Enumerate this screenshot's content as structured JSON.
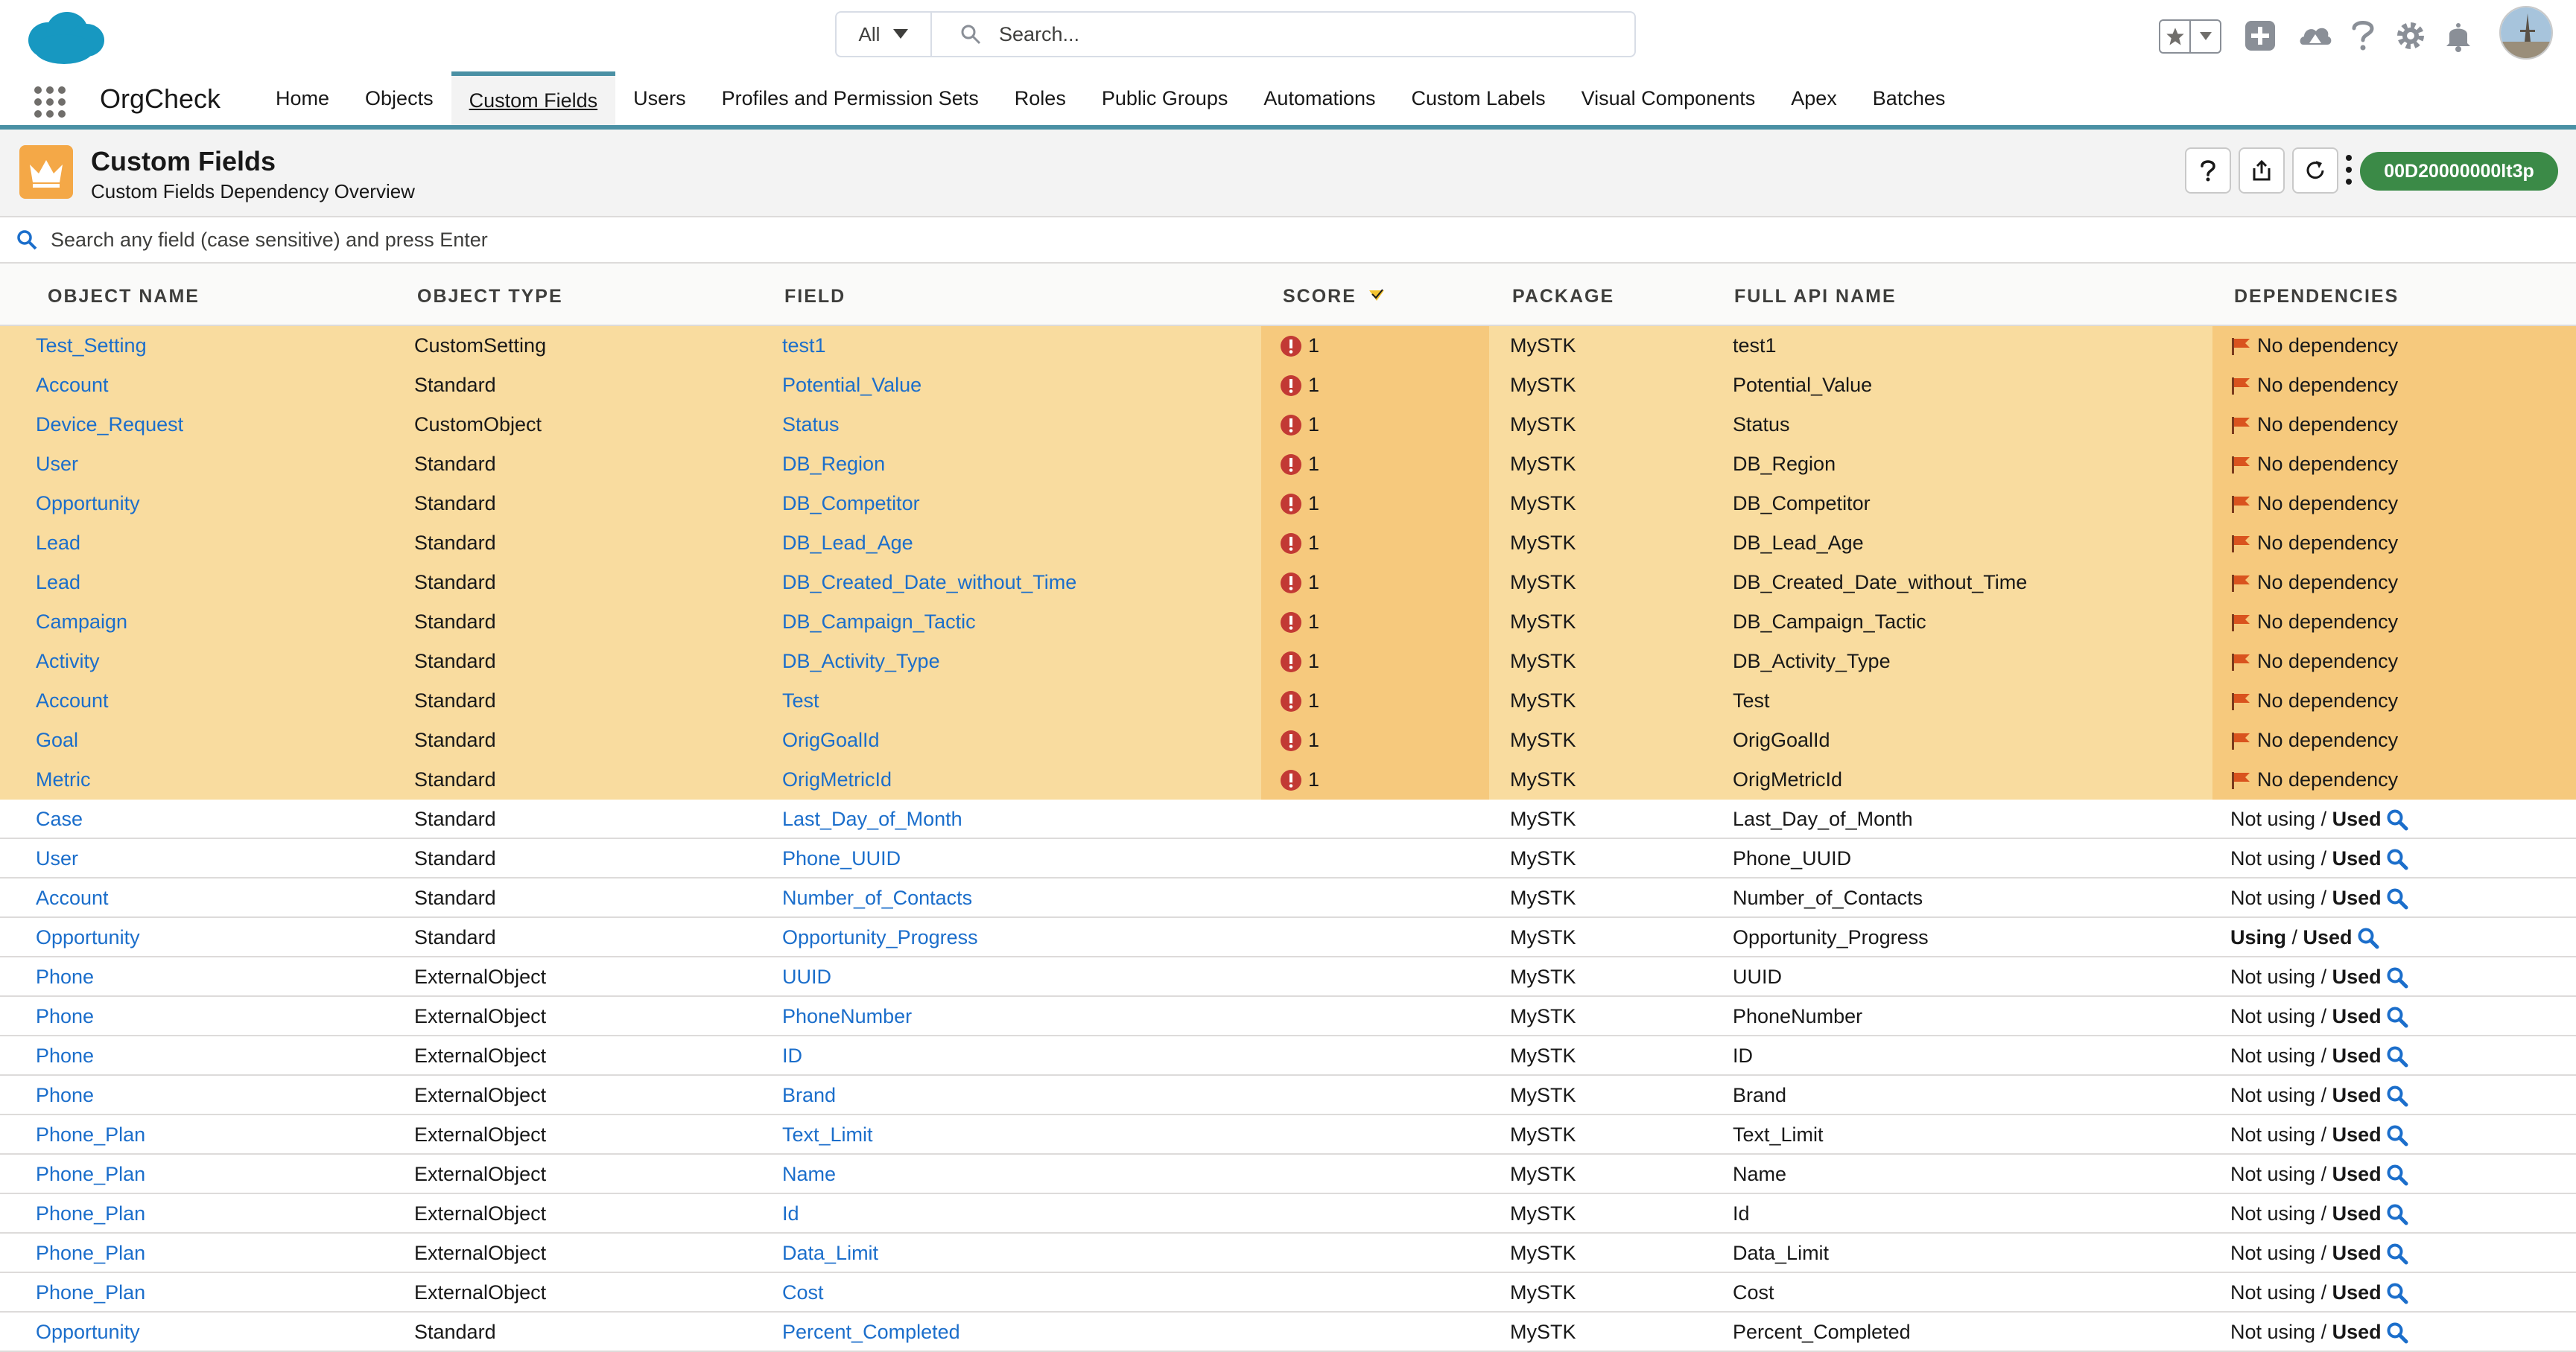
{
  "global": {
    "search_scope": "All",
    "search_placeholder": "Search..."
  },
  "nav": {
    "app_name": "OrgCheck",
    "items": [
      "Home",
      "Objects",
      "Custom Fields",
      "Users",
      "Profiles and Permission Sets",
      "Roles",
      "Public Groups",
      "Automations",
      "Custom Labels",
      "Visual Components",
      "Apex",
      "Batches"
    ],
    "active_index": 2
  },
  "page_header": {
    "title": "Custom Fields",
    "subtitle": "Custom Fields Dependency Overview",
    "org_id": "00D20000000lt3p"
  },
  "filter": {
    "placeholder": "Search any field (case sensitive) and press Enter"
  },
  "table": {
    "columns": [
      "OBJECT NAME",
      "OBJECT TYPE",
      "FIELD",
      "SCORE",
      "PACKAGE",
      "FULL API NAME",
      "DEPENDENCIES"
    ],
    "rows": [
      {
        "object": "Test_Setting",
        "type": "CustomSetting",
        "field": "test1",
        "score": "1",
        "package": "MySTK",
        "api": "test1",
        "dep": "No dependency"
      },
      {
        "object": "Account",
        "type": "Standard",
        "field": "Potential_Value",
        "score": "1",
        "package": "MySTK",
        "api": "Potential_Value",
        "dep": "No dependency"
      },
      {
        "object": "Device_Request",
        "type": "CustomObject",
        "field": "Status",
        "score": "1",
        "package": "MySTK",
        "api": "Status",
        "dep": "No dependency"
      },
      {
        "object": "User",
        "type": "Standard",
        "field": "DB_Region",
        "score": "1",
        "package": "MySTK",
        "api": "DB_Region",
        "dep": "No dependency"
      },
      {
        "object": "Opportunity",
        "type": "Standard",
        "field": "DB_Competitor",
        "score": "1",
        "package": "MySTK",
        "api": "DB_Competitor",
        "dep": "No dependency"
      },
      {
        "object": "Lead",
        "type": "Standard",
        "field": "DB_Lead_Age",
        "score": "1",
        "package": "MySTK",
        "api": "DB_Lead_Age",
        "dep": "No dependency"
      },
      {
        "object": "Lead",
        "type": "Standard",
        "field": "DB_Created_Date_without_Time",
        "score": "1",
        "package": "MySTK",
        "api": "DB_Created_Date_without_Time",
        "dep": "No dependency"
      },
      {
        "object": "Campaign",
        "type": "Standard",
        "field": "DB_Campaign_Tactic",
        "score": "1",
        "package": "MySTK",
        "api": "DB_Campaign_Tactic",
        "dep": "No dependency"
      },
      {
        "object": "Activity",
        "type": "Standard",
        "field": "DB_Activity_Type",
        "score": "1",
        "package": "MySTK",
        "api": "DB_Activity_Type",
        "dep": "No dependency"
      },
      {
        "object": "Account",
        "type": "Standard",
        "field": "Test",
        "score": "1",
        "package": "MySTK",
        "api": "Test",
        "dep": "No dependency"
      },
      {
        "object": "Goal",
        "type": "Standard",
        "field": "OrigGoalId",
        "score": "1",
        "package": "MySTK",
        "api": "OrigGoalId",
        "dep": "No dependency"
      },
      {
        "object": "Metric",
        "type": "Standard",
        "field": "OrigMetricId",
        "score": "1",
        "package": "MySTK",
        "api": "OrigMetricId",
        "dep": "No dependency"
      },
      {
        "object": "Case",
        "type": "Standard",
        "field": "Last_Day_of_Month",
        "score": "",
        "package": "MySTK",
        "api": "Last_Day_of_Month",
        "using": "Not using",
        "used": "Used",
        "using_bold": false
      },
      {
        "object": "User",
        "type": "Standard",
        "field": "Phone_UUID",
        "score": "",
        "package": "MySTK",
        "api": "Phone_UUID",
        "using": "Not using",
        "used": "Used",
        "using_bold": false
      },
      {
        "object": "Account",
        "type": "Standard",
        "field": "Number_of_Contacts",
        "score": "",
        "package": "MySTK",
        "api": "Number_of_Contacts",
        "using": "Not using",
        "used": "Used",
        "using_bold": false
      },
      {
        "object": "Opportunity",
        "type": "Standard",
        "field": "Opportunity_Progress",
        "score": "",
        "package": "MySTK",
        "api": "Opportunity_Progress",
        "using": "Using",
        "used": "Used",
        "using_bold": true
      },
      {
        "object": "Phone",
        "type": "ExternalObject",
        "field": "UUID",
        "score": "",
        "package": "MySTK",
        "api": "UUID",
        "using": "Not using",
        "used": "Used",
        "using_bold": false
      },
      {
        "object": "Phone",
        "type": "ExternalObject",
        "field": "PhoneNumber",
        "score": "",
        "package": "MySTK",
        "api": "PhoneNumber",
        "using": "Not using",
        "used": "Used",
        "using_bold": false
      },
      {
        "object": "Phone",
        "type": "ExternalObject",
        "field": "ID",
        "score": "",
        "package": "MySTK",
        "api": "ID",
        "using": "Not using",
        "used": "Used",
        "using_bold": false
      },
      {
        "object": "Phone",
        "type": "ExternalObject",
        "field": "Brand",
        "score": "",
        "package": "MySTK",
        "api": "Brand",
        "using": "Not using",
        "used": "Used",
        "using_bold": false
      },
      {
        "object": "Phone_Plan",
        "type": "ExternalObject",
        "field": "Text_Limit",
        "score": "",
        "package": "MySTK",
        "api": "Text_Limit",
        "using": "Not using",
        "used": "Used",
        "using_bold": false
      },
      {
        "object": "Phone_Plan",
        "type": "ExternalObject",
        "field": "Name",
        "score": "",
        "package": "MySTK",
        "api": "Name",
        "using": "Not using",
        "used": "Used",
        "using_bold": false
      },
      {
        "object": "Phone_Plan",
        "type": "ExternalObject",
        "field": "Id",
        "score": "",
        "package": "MySTK",
        "api": "Id",
        "using": "Not using",
        "used": "Used",
        "using_bold": false
      },
      {
        "object": "Phone_Plan",
        "type": "ExternalObject",
        "field": "Data_Limit",
        "score": "",
        "package": "MySTK",
        "api": "Data_Limit",
        "using": "Not using",
        "used": "Used",
        "using_bold": false
      },
      {
        "object": "Phone_Plan",
        "type": "ExternalObject",
        "field": "Cost",
        "score": "",
        "package": "MySTK",
        "api": "Cost",
        "using": "Not using",
        "used": "Used",
        "using_bold": false
      },
      {
        "object": "Opportunity",
        "type": "Standard",
        "field": "Percent_Completed",
        "score": "",
        "package": "MySTK",
        "api": "Percent_Completed",
        "using": "Not using",
        "used": "Used",
        "using_bold": false
      }
    ]
  },
  "colors": {
    "accent": "#4a90a4",
    "link": "#1b6ecb",
    "row_warning": "#f9dc9f",
    "score_cell": "#f6c97d",
    "error": "#c23934",
    "org_badge": "#3b8a47"
  }
}
